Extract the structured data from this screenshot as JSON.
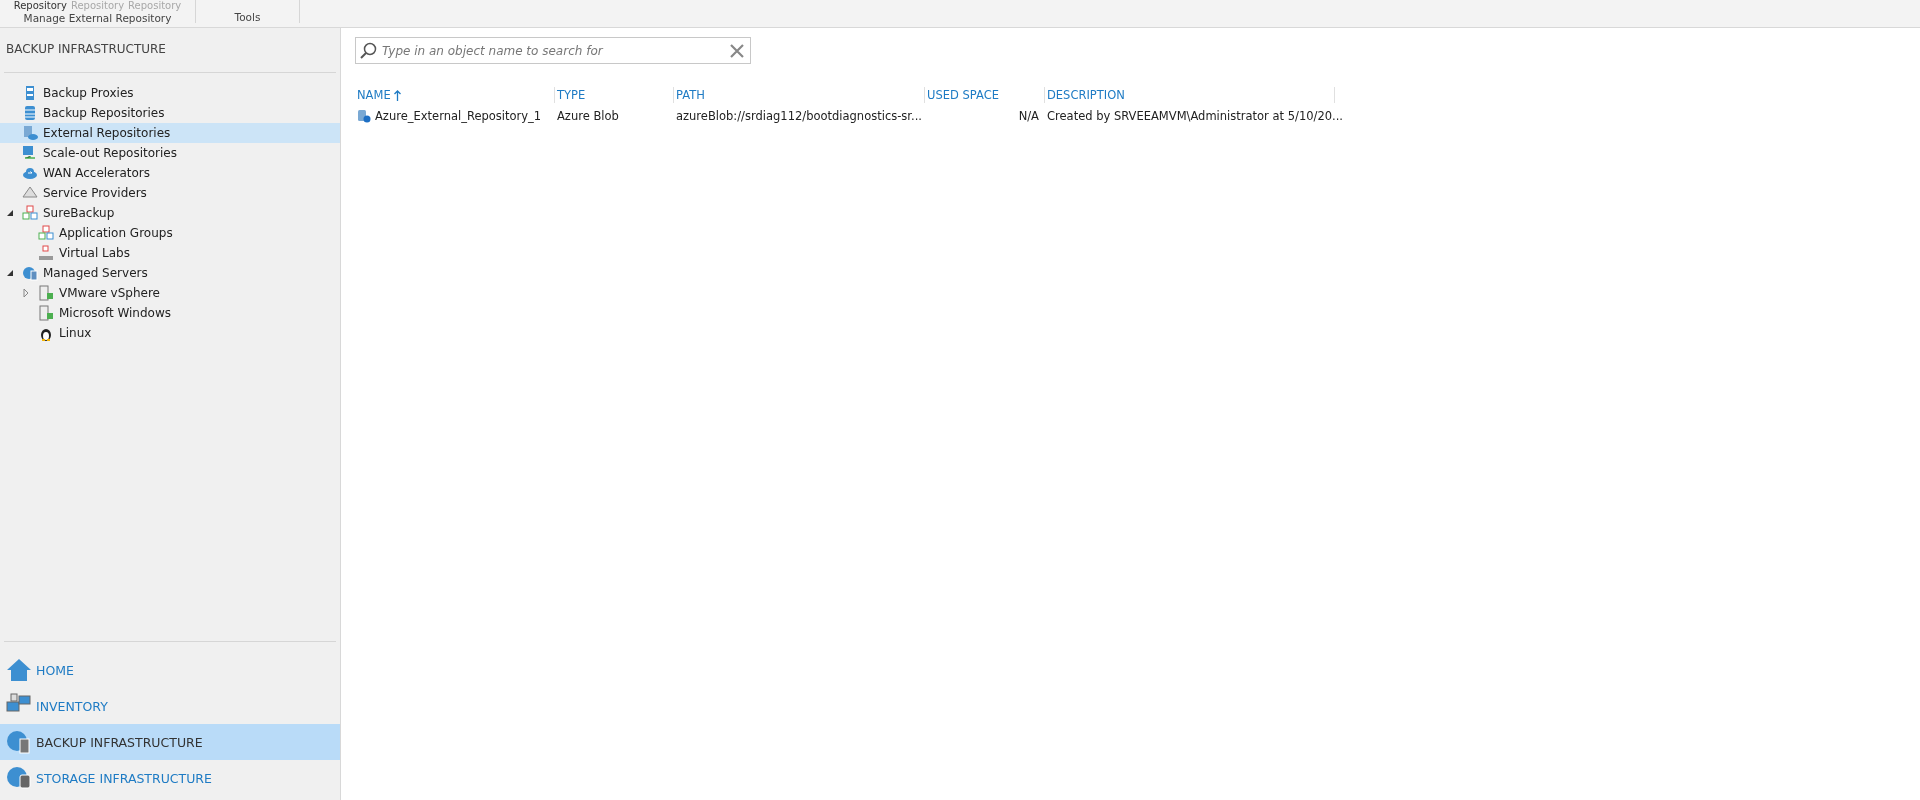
{
  "ribbon": {
    "buttons": [
      {
        "label": "Repository",
        "disabled": false
      },
      {
        "label": "Repository",
        "disabled": true
      },
      {
        "label": "Repository",
        "disabled": true
      }
    ],
    "groups": [
      "Manage External Repository",
      "Tools"
    ]
  },
  "sidebar": {
    "title": "BACKUP INFRASTRUCTURE",
    "tree": [
      {
        "label": "Backup Proxies",
        "selected": false
      },
      {
        "label": "Backup Repositories",
        "selected": false
      },
      {
        "label": "External Repositories",
        "selected": true
      },
      {
        "label": "Scale-out Repositories",
        "selected": false
      },
      {
        "label": "WAN Accelerators",
        "selected": false
      },
      {
        "label": "Service Providers",
        "selected": false
      },
      {
        "label": "SureBackup",
        "selected": false,
        "expanded": true,
        "children": [
          {
            "label": "Application Groups",
            "selected": false
          },
          {
            "label": "Virtual Labs",
            "selected": false
          }
        ]
      },
      {
        "label": "Managed Servers",
        "selected": false,
        "expanded": true,
        "children": [
          {
            "label": "VMware vSphere",
            "selected": false,
            "expanded": false
          },
          {
            "label": "Microsoft Windows",
            "selected": false
          },
          {
            "label": "Linux",
            "selected": false
          }
        ]
      }
    ],
    "nav": [
      {
        "label": "HOME",
        "selected": false
      },
      {
        "label": "INVENTORY",
        "selected": false
      },
      {
        "label": "BACKUP INFRASTRUCTURE",
        "selected": true
      },
      {
        "label": "STORAGE INFRASTRUCTURE",
        "selected": false
      }
    ]
  },
  "search": {
    "placeholder": "Type in an object name to search for"
  },
  "table": {
    "columns": [
      {
        "label": "NAME",
        "sorted": true
      },
      {
        "label": "TYPE",
        "sorted": false
      },
      {
        "label": "PATH",
        "sorted": false
      },
      {
        "label": "USED SPACE",
        "sorted": false
      },
      {
        "label": "DESCRIPTION",
        "sorted": false
      }
    ],
    "rows": [
      [
        "Azure_External_Repository_1",
        "Azure Blob",
        "azureBlob://srdiag112/bootdiagnostics-sr...",
        "N/A",
        "Created by SRVEEAMVM\\Administrator at 5/10/20..."
      ]
    ]
  }
}
